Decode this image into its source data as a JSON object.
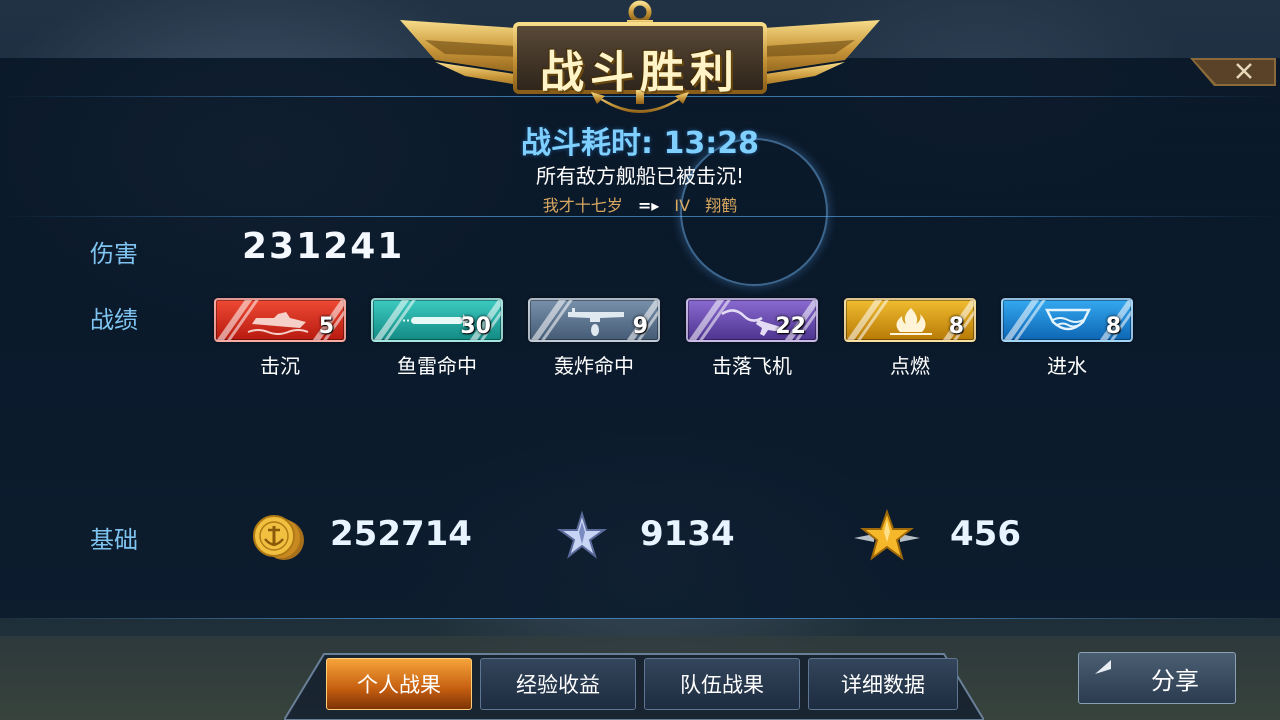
{
  "header": {
    "title": "战斗胜利"
  },
  "summary": {
    "duration": "战斗耗时: 13:28",
    "result_message": "所有敌方舰船已被击沉!",
    "player_name": "我才十七岁",
    "arrow": "=▸",
    "ship_tier": "IV",
    "ship_name": "翔鹤"
  },
  "damage": {
    "label": "伤害",
    "value": "231241"
  },
  "achievements": {
    "label": "战绩",
    "items": [
      {
        "label": "击沉",
        "count": "5",
        "color": "#d42a1a",
        "icon": "sinking-ship-icon"
      },
      {
        "label": "鱼雷命中",
        "count": "30",
        "color": "#1aa8a0",
        "icon": "torpedo-icon"
      },
      {
        "label": "轰炸命中",
        "count": "9",
        "color": "#5a7090",
        "icon": "bomber-icon"
      },
      {
        "label": "击落飞机",
        "count": "22",
        "color": "#6a4aa8",
        "icon": "falling-plane-icon"
      },
      {
        "label": "点燃",
        "count": "8",
        "color": "#d89a10",
        "icon": "fire-icon"
      },
      {
        "label": "进水",
        "count": "8",
        "color": "#1a86d8",
        "icon": "flooding-icon"
      }
    ]
  },
  "base": {
    "label": "基础",
    "credits": "252714",
    "experience": "9134",
    "commander_xp": "456"
  },
  "tabs": [
    "个人战果",
    "经验收益",
    "队伍战果",
    "详细数据"
  ],
  "active_tab": 0,
  "share": {
    "label": "分享"
  }
}
